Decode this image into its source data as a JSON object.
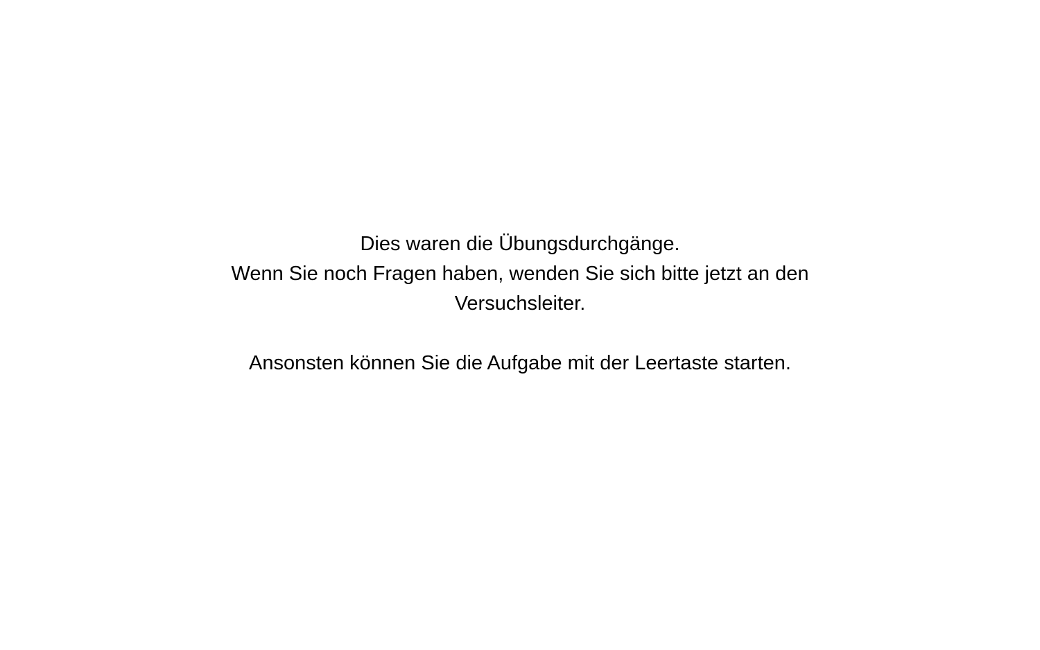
{
  "instructions": {
    "line1": "Dies waren die Übungsdurchgänge.",
    "line2": "Wenn Sie noch Fragen haben, wenden Sie sich bitte jetzt an den",
    "line3": "Versuchsleiter.",
    "line4": "Ansonsten können Sie die Aufgabe mit der Leertaste starten."
  },
  "colors": {
    "background": "#ffffff",
    "text": "#000000"
  }
}
